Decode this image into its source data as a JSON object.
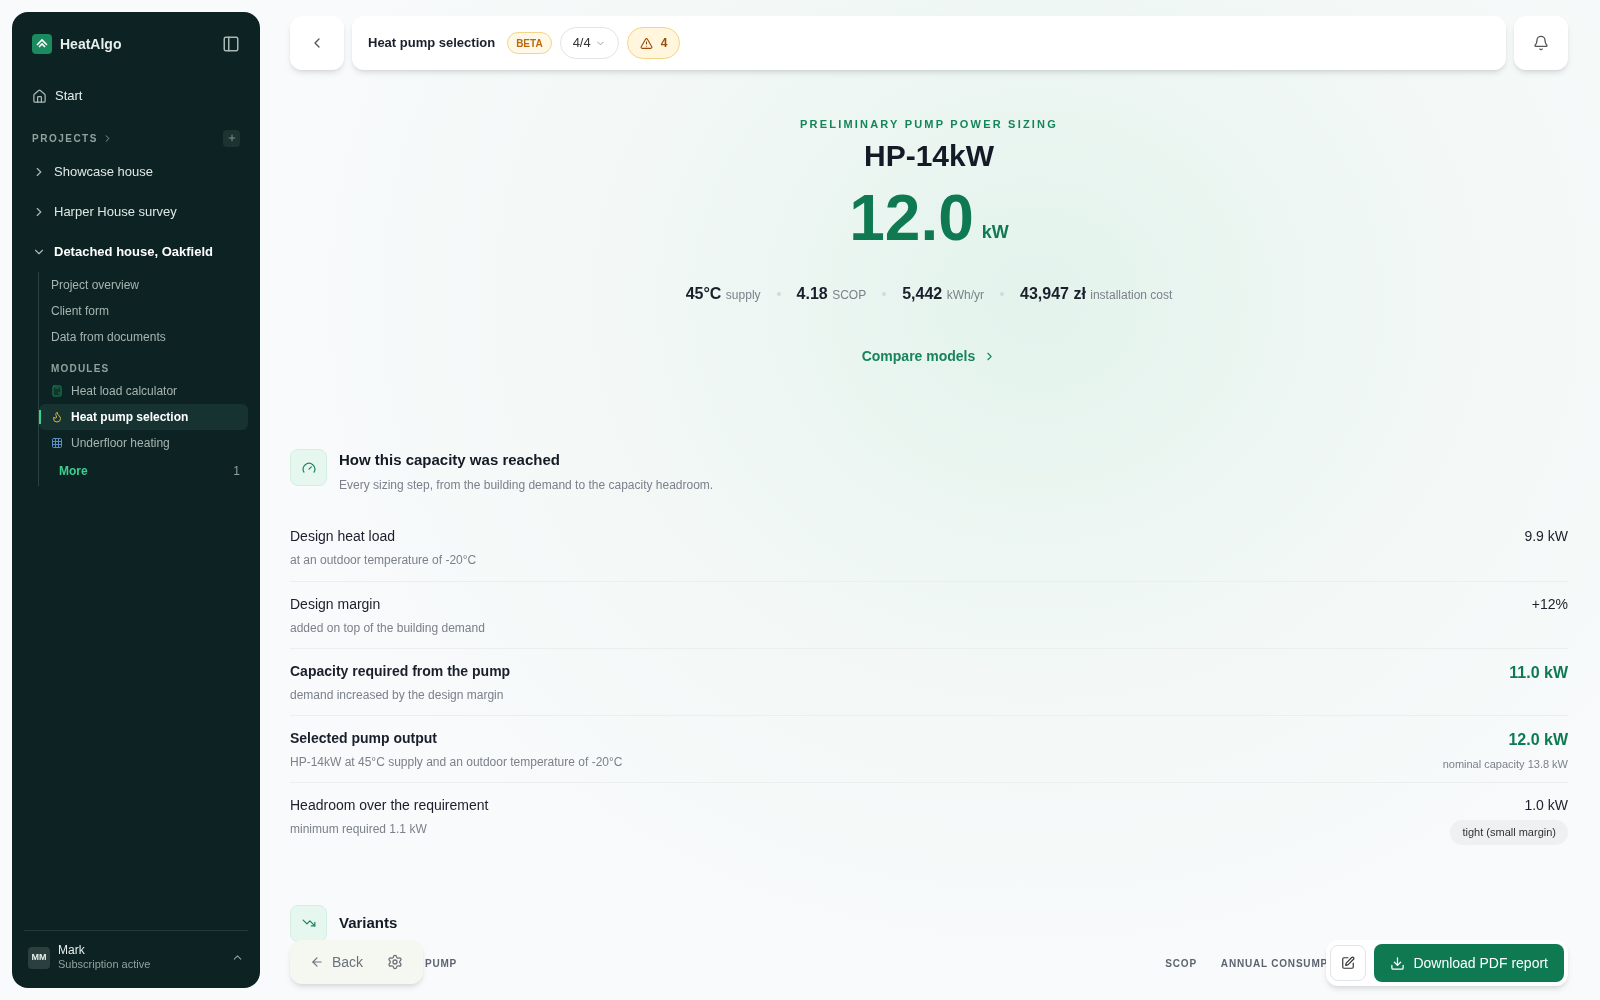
{
  "sidebar": {
    "brand": "HeatAlgo",
    "start": "Start",
    "projects_label": "PROJECTS",
    "projects": [
      {
        "name": "Showcase house",
        "expanded": false
      },
      {
        "name": "Harper House survey",
        "expanded": false
      },
      {
        "name": "Detached house, Oakfield",
        "expanded": true,
        "links": [
          "Project overview",
          "Client form",
          "Data from documents"
        ],
        "modules_label": "MODULES",
        "modules": [
          {
            "label": "Heat load calculator",
            "kind": "calculator",
            "selected": false
          },
          {
            "label": "Heat pump selection",
            "kind": "flame",
            "selected": true
          },
          {
            "label": "Underfloor heating",
            "kind": "grid",
            "selected": false
          }
        ],
        "more": {
          "label": "More",
          "count": "1"
        }
      }
    ],
    "user": {
      "initials": "MM",
      "name": "Mark",
      "status": "Subscription active"
    }
  },
  "header": {
    "title": "Heat pump selection",
    "badge": "BETA",
    "step": "4/4",
    "warnings": "4"
  },
  "hero": {
    "eyebrow": "PRELIMINARY PUMP POWER SIZING",
    "model": "HP-14kW",
    "power": "12.0",
    "unit": "kW",
    "stats": [
      {
        "value": "45°C",
        "label": "supply"
      },
      {
        "value": "4.18",
        "label": "SCOP"
      },
      {
        "value": "5,442",
        "label": "kWh/yr"
      },
      {
        "value": "43,947 zł",
        "label": "installation cost"
      }
    ],
    "link": "Compare models"
  },
  "breakdown": {
    "title": "How this capacity was reached",
    "subtitle": "Every sizing step, from the building demand to the capacity headroom.",
    "rows": [
      {
        "label": "Design heat load",
        "detail": "at an outdoor temperature of -20°C",
        "value": "9.9 kW",
        "highlight": false
      },
      {
        "label": "Design margin",
        "detail": "added on top of the building demand",
        "value": "+12%",
        "highlight": false
      },
      {
        "label": "Capacity required from the pump",
        "detail": "demand increased by the design margin",
        "value": "11.0 kW",
        "highlight": true
      },
      {
        "label": "Selected pump output",
        "detail": "HP-14kW at 45°C supply and an outdoor temperature of -20°C",
        "value": "12.0 kW",
        "highlight": true,
        "note": "nominal capacity 13.8 kW"
      },
      {
        "label": "Headroom over the requirement",
        "detail": "minimum required 1.1 kW",
        "value": "1.0 kW",
        "highlight": false,
        "badge": "tight (small margin)"
      }
    ]
  },
  "variants": {
    "title": "Variants",
    "columns": [
      "PUMP",
      "SCOP",
      "ANNUAL CONSUMP"
    ]
  },
  "footer_left": {
    "back": "Back"
  },
  "footer_right": {
    "download": "Download PDF report"
  }
}
